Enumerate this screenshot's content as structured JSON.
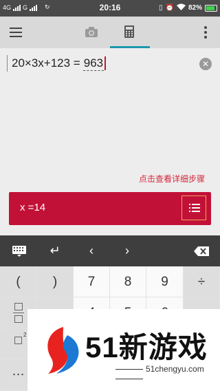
{
  "status_bar": {
    "network_1": "4G",
    "network_2": "G",
    "time": "20:16",
    "battery": "82%"
  },
  "toolbar": {
    "active_tab": "calculator",
    "accent_color": "#1b97ad"
  },
  "input": {
    "expression": "20×3x+123 =",
    "answer": "963"
  },
  "steps_link": "点击查看详细步骤",
  "result": {
    "text": "x =14",
    "color": "#c21137"
  },
  "keyboard": {
    "nav_keys": [
      "keyboard-icon",
      "enter-icon",
      "left-arrow-icon",
      "right-arrow-icon",
      "backspace-icon"
    ],
    "row1": [
      "(",
      ")",
      "7",
      "8",
      "9",
      "÷"
    ],
    "row2_visible": [
      "4",
      "5",
      "6"
    ]
  },
  "watermark": {
    "brand": "51新游戏",
    "url": "51chengyu.com"
  }
}
